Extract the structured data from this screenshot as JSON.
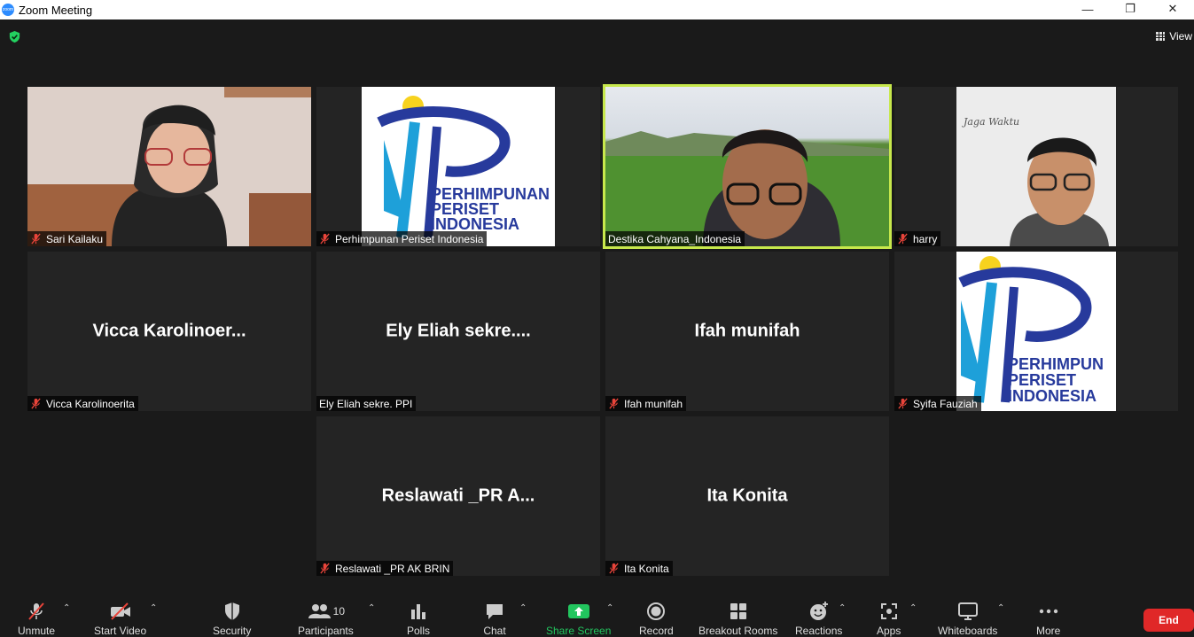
{
  "window": {
    "title": "Zoom Meeting"
  },
  "view_button": {
    "label": "View"
  },
  "tiles": [
    {
      "label": "Sari Kailaku",
      "muted": true,
      "kind": "video"
    },
    {
      "label": "Perhimpunan Periset Indonesia",
      "muted": true,
      "kind": "logo"
    },
    {
      "label": "Destika Cahyana_Indonesia",
      "muted": false,
      "kind": "video",
      "speaking": true
    },
    {
      "label": "harry",
      "muted": true,
      "kind": "video"
    },
    {
      "big_name": "Vicca  Karolinoer...",
      "label": "Vicca Karolinoerita",
      "muted": true
    },
    {
      "big_name": "Ely Eliah  sekre....",
      "label": "Ely Eliah  sekre.  PPI",
      "muted": false
    },
    {
      "big_name": "Ifah munifah",
      "label": "Ifah munifah",
      "muted": true
    },
    {
      "label": "Syifa Fauziah",
      "muted": true,
      "kind": "logo"
    },
    {
      "big_name": "Reslawati _PR A...",
      "label": "Reslawati _PR AK BRIN",
      "muted": true
    },
    {
      "big_name": "Ita Konita",
      "label": "Ita Konita",
      "muted": true
    }
  ],
  "logo": {
    "line1": "PERHIMPUNAN",
    "line2": "PERISET",
    "line3": "INDONESIA",
    "line1_short": "PERHIMPUN"
  },
  "harry_board": {
    "line1": "Jaga Waktu"
  },
  "toolbar": {
    "unmute": "Unmute",
    "start_video": "Start Video",
    "security": "Security",
    "participants": "Participants",
    "participants_count": "10",
    "polls": "Polls",
    "chat": "Chat",
    "share_screen": "Share Screen",
    "record": "Record",
    "breakout_rooms": "Breakout Rooms",
    "reactions": "Reactions",
    "apps": "Apps",
    "whiteboards": "Whiteboards",
    "more": "More",
    "end": "End"
  },
  "colors": {
    "speaking_border": "#c7e84c",
    "share_green": "#22c55e",
    "end_red": "#e02828",
    "logo_blue": "#273a9c",
    "logo_cyan": "#1ea0d9",
    "logo_sun": "#f7d21e"
  }
}
